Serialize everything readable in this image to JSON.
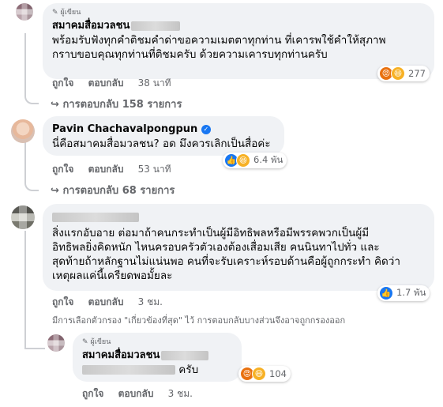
{
  "comments": [
    {
      "author_badge": "ผู้เขียน",
      "author": "สมาคมสื่อมวลชน",
      "text_lines": [
        "พร้อมรับฟังทุกคำติชมคำด่าขอความเมตตาทุกท่าน ที่เคารพใช้คำให้สุภาพ",
        "กราบขอบคุณทุกท่านที่ติชมครับ ด้วยความเคารบทุกท่านครับ"
      ],
      "like": "ถูกใจ",
      "reply": "ตอบกลับ",
      "time": "38 นาที",
      "reaction_count": "277",
      "replies_link": "การตอบกลับ 158 รายการ"
    },
    {
      "author": "Pavin Chachavalpongpun",
      "text_lines": [
        "นี่คือสมาคมสื่อมวลชน? อด มึงควรเลิกเป็นสื่อค่ะ"
      ],
      "like": "ถูกใจ",
      "reply": "ตอบกลับ",
      "time": "53 นาที",
      "reaction_count": "6.4 พัน",
      "replies_link": "การตอบกลับ 68 รายการ"
    },
    {
      "text_lines": [
        "สิ่งแรกอับอาย ต่อมาถ้าคนกระทำเป็นผู้มีอิทธิพลหรือมีพรรคพวกเป็นผู้มี",
        "อิทธิพลยิ่งคิดหนัก ไหนครอบครัวตัวเองต้องเสื่อมเสีย คนนินทาไปทั่ว และ",
        "สุดท้ายถ้าหลักฐานไม่แน่นพอ คนที่จะรับเคราะห์รอบด้านคือผู้ถูกกระทำ คิดว่า",
        "เหตุผลแค่นี้เครียดพอมั้ยละ"
      ],
      "like": "ถูกใจ",
      "reply": "ตอบกลับ",
      "time": "3 ชม.",
      "reaction_count": "1.7 พัน"
    }
  ],
  "filter_notice": "มีการเลือกตัวกรอง \"เกี่ยวข้องที่สุด\" ไว้ การตอบกลับบางส่วนจึงอาจถูกกรองออก",
  "reply": {
    "author_badge": "ผู้เขียน",
    "author": "สมาคมสื่อมวลชน",
    "text_suffix": "ครับ",
    "like": "ถูกใจ",
    "reply": "ตอบกลับ",
    "time": "3 ชม.",
    "reaction_count": "104"
  }
}
